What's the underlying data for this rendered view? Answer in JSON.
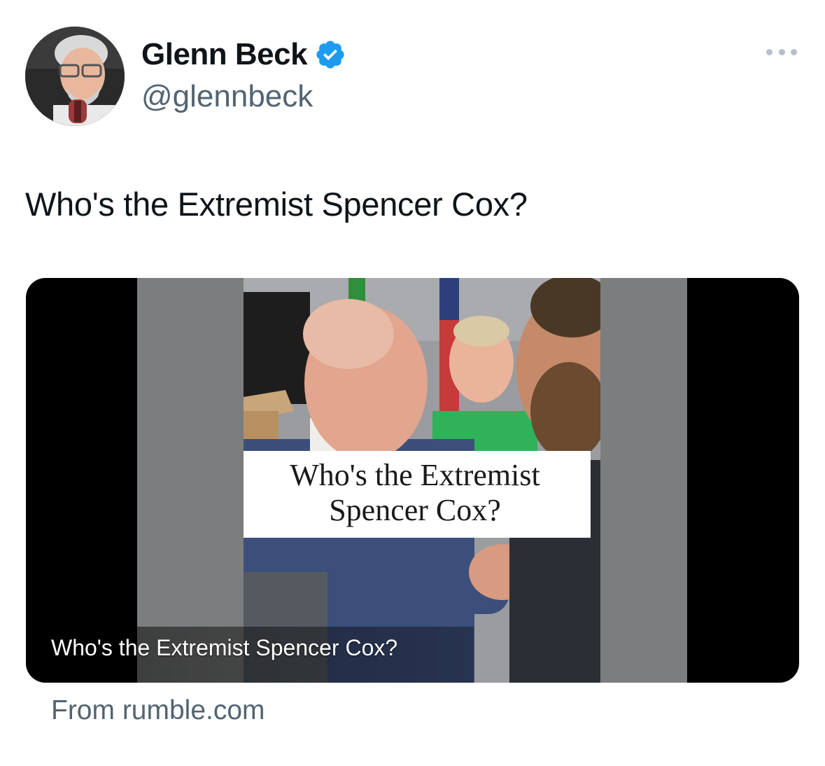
{
  "author": {
    "display_name": "Glenn Beck",
    "handle": "@glennbeck",
    "verified": true,
    "verified_color": "#1d9bf0",
    "avatar_icon": "profile-photo"
  },
  "more_menu_icon": "more-horizontal-icon",
  "tweet": {
    "text": "Who's the Extremist Spencer Cox?"
  },
  "card": {
    "overlay_title_line1": "Who's the Extremist",
    "overlay_title_line2": "Spencer Cox?",
    "caption": "Who's the Extremist Spencer Cox?",
    "source": "From rumble.com"
  },
  "colors": {
    "text_primary": "#0f1419",
    "text_secondary": "#536471",
    "card_background": "#000000"
  }
}
